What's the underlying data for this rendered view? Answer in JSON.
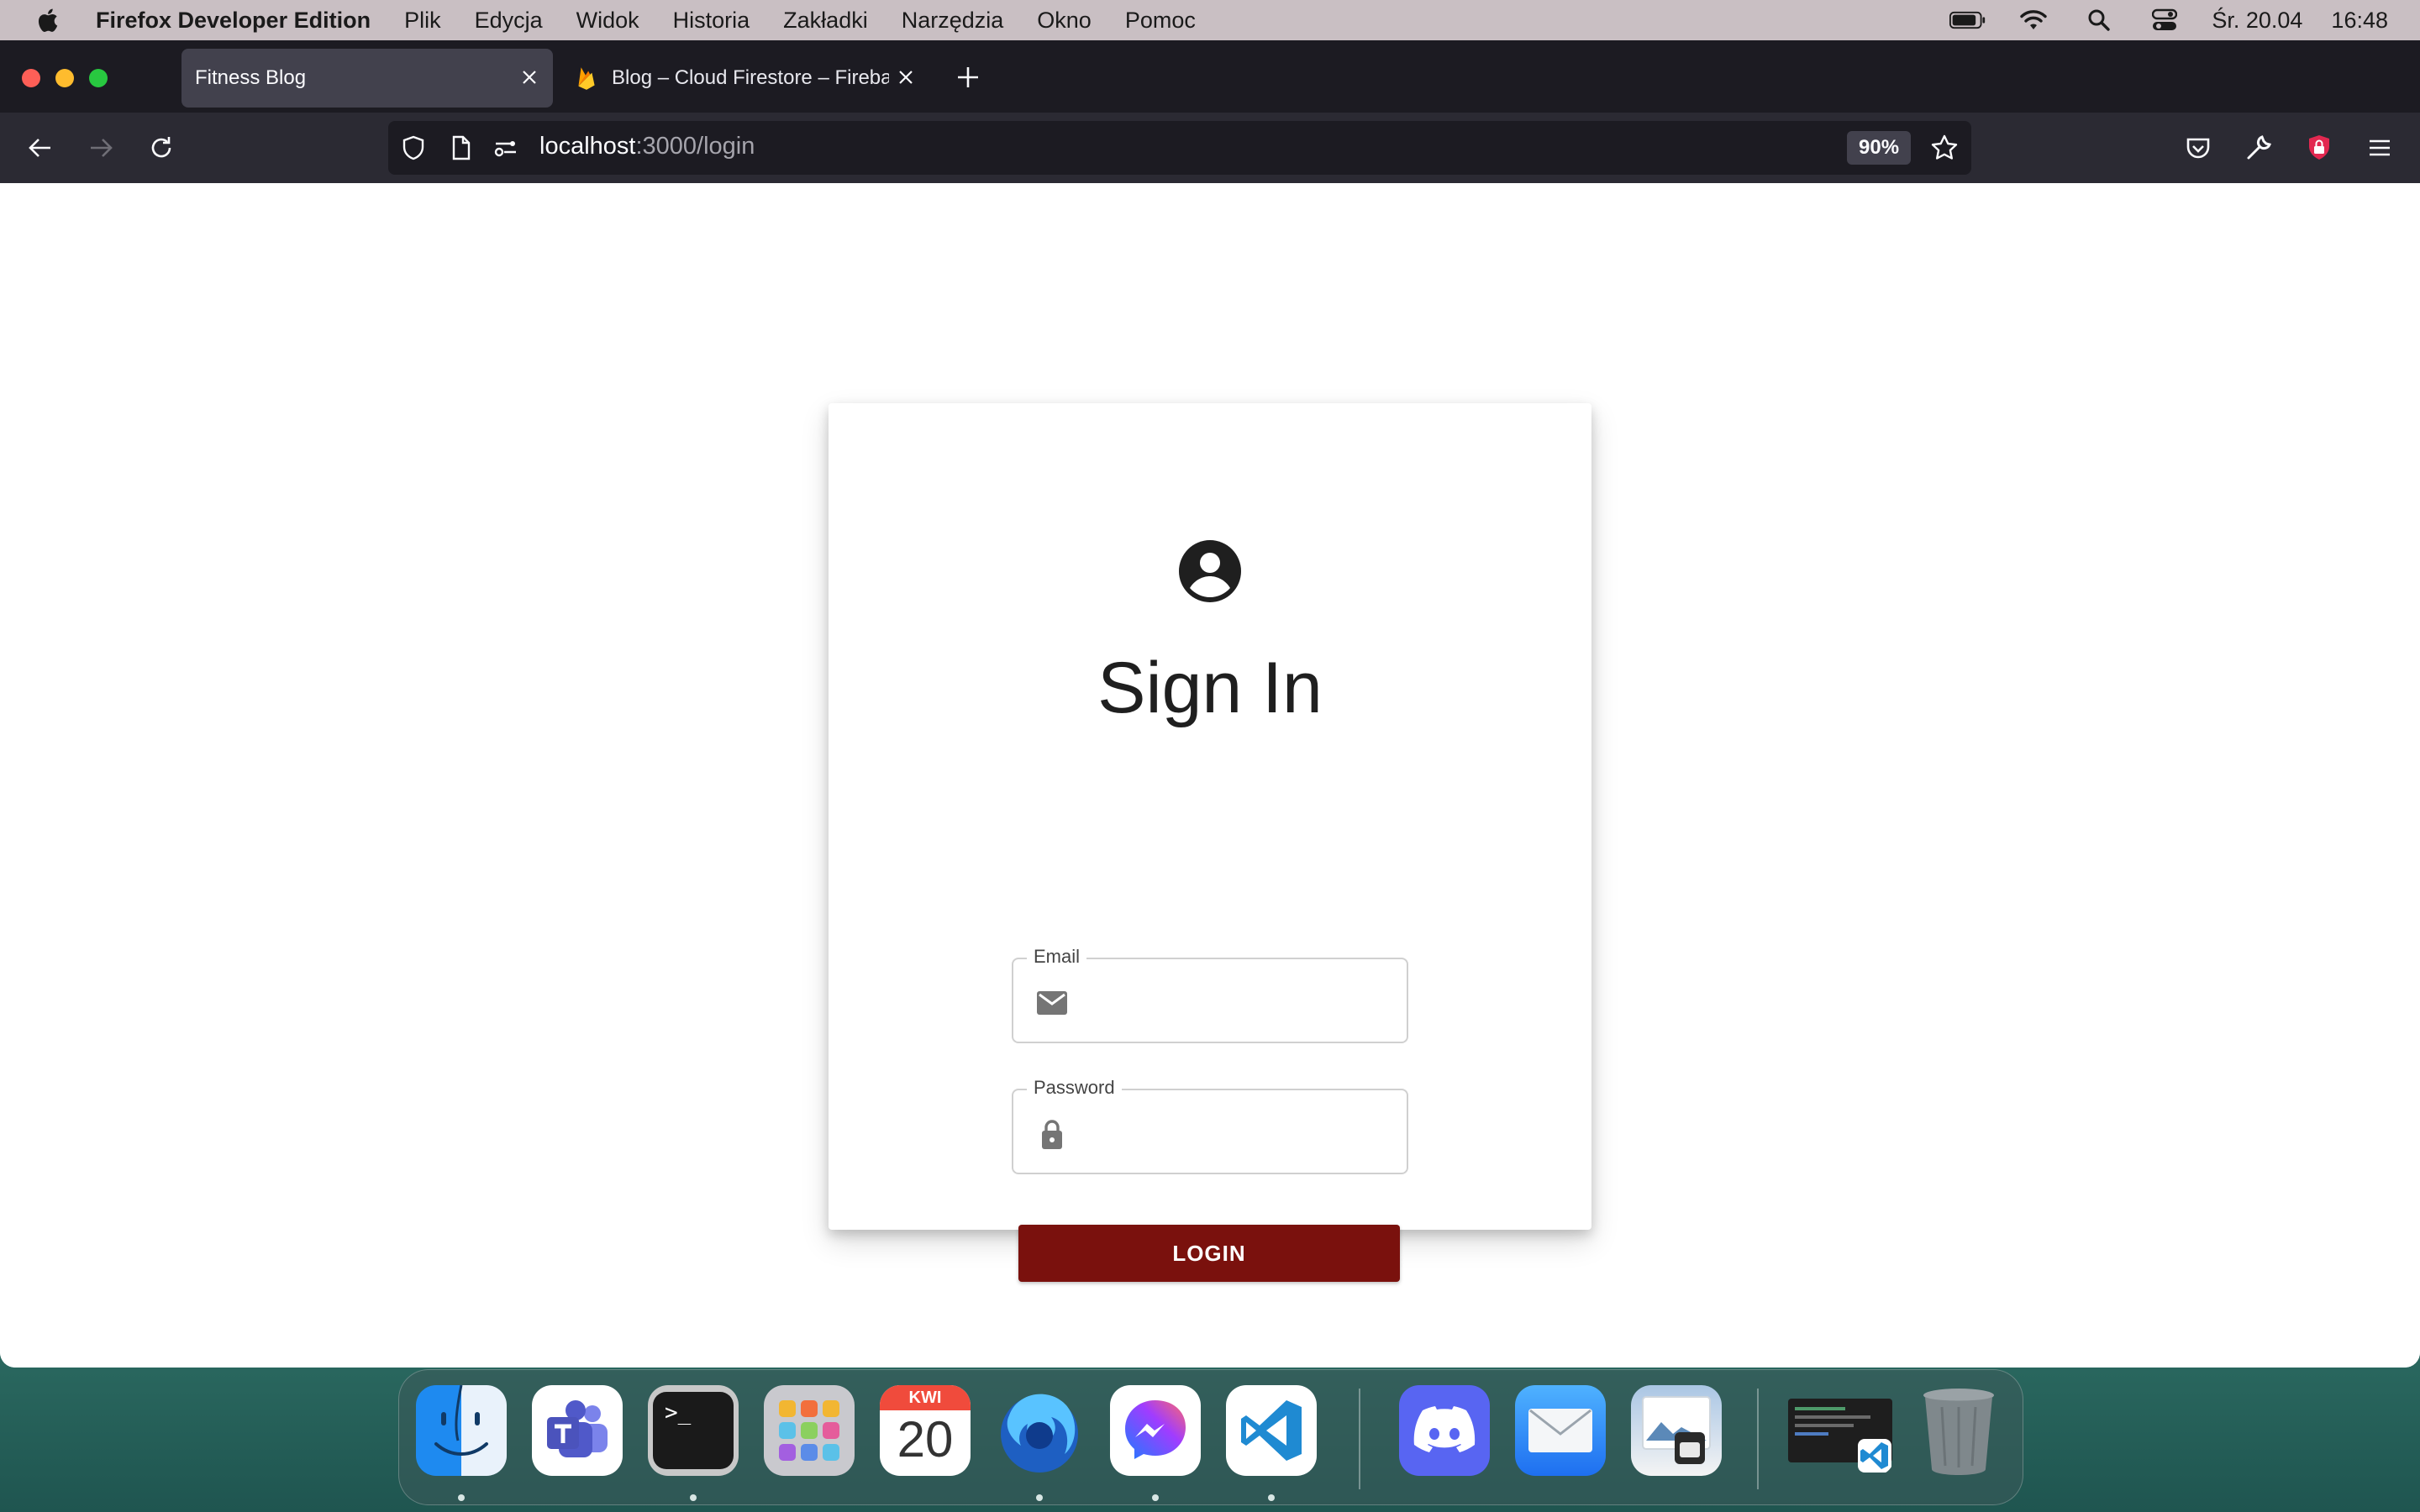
{
  "menubar": {
    "app_name": "Firefox Developer Edition",
    "items": [
      "Plik",
      "Edycja",
      "Widok",
      "Historia",
      "Zakładki",
      "Narzędzia",
      "Okno",
      "Pomoc"
    ],
    "date": "Śr. 20.04",
    "time": "16:48"
  },
  "browser": {
    "tabs": [
      {
        "title": "Fitness Blog",
        "active": true
      },
      {
        "title": "Blog – Cloud Firestore – Firebase",
        "active": false
      }
    ],
    "url": {
      "host": "localhost",
      "path": ":3000/login"
    },
    "zoom": "90%"
  },
  "login": {
    "title": "Sign In",
    "email_label": "Email",
    "email_value": "",
    "password_label": "Password",
    "password_value": "",
    "button_label": "LOGIN",
    "button_color": "#7a110d"
  },
  "dock": {
    "calendar_month": "KWI",
    "calendar_day": "20",
    "apps": [
      "Finder",
      "Microsoft Teams",
      "Terminal",
      "Launchpad",
      "Calendar",
      "Firefox Developer Edition",
      "Messenger",
      "Visual Studio Code",
      "Discord",
      "Mail",
      "Preview",
      "Visual Studio Code Window",
      "Trash"
    ]
  }
}
